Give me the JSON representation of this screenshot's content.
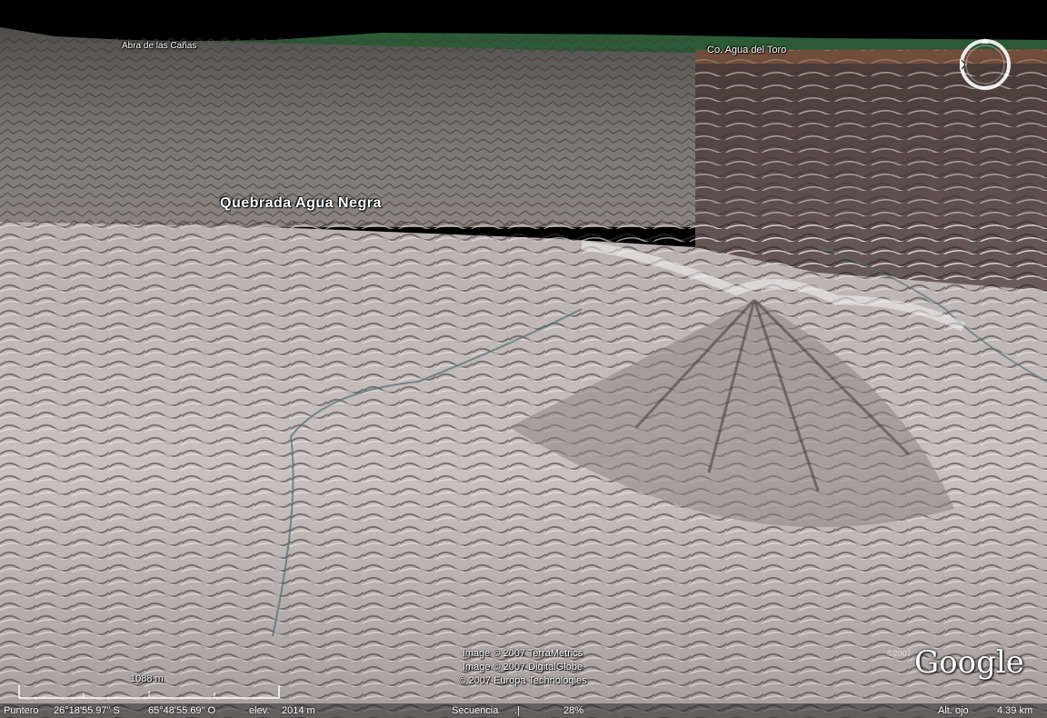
{
  "map": {
    "labels": {
      "abra_de_las_canas": "Abra de las Cañas",
      "agua_del_toro": "Co. Agua del Toro",
      "quebrada_agua_negra": "Quebrada Agua Negra"
    },
    "attribution": {
      "line1": "Image © 2007 TerraMetrics",
      "line2": "Image © 2007 DigitalGlobe",
      "line3": "© 2007 Europa Technologies"
    },
    "google_logo": "Google",
    "google_copyright": "©2007",
    "scale_label": "1088 m",
    "compass_icon": "north-compass-icon"
  },
  "status_bar": {
    "pointer_label": "Puntero",
    "latitude": "26°18'55.97\" S",
    "longitude": "65°48'55.69\" O",
    "elevation_label": "elev.",
    "elevation_value": "2014 m",
    "stream_label": "Secuencia",
    "stream_icon_text": ".|",
    "stream_percent": "28%",
    "eye_alt_label": "Alt. ojo",
    "eye_alt_value": "4.39 km"
  },
  "colors": {
    "sky": "#000000",
    "horizon_green": "#2d5a36",
    "terrain_far": "#6f6c68",
    "terrain_near": "#cfc6c6",
    "terrain_dark": "#3c3336"
  }
}
